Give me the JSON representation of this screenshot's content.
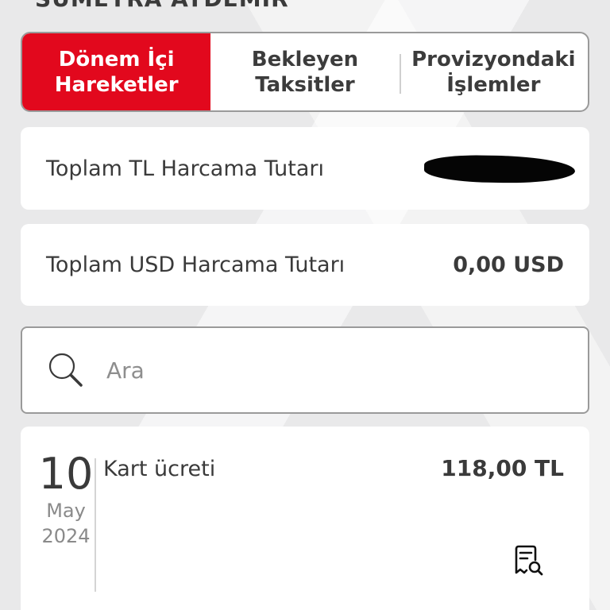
{
  "header": {
    "owner_name": "SÜMEYRA AYDEMİR"
  },
  "tabs": [
    {
      "label_line1": "Dönem İçi",
      "label_line2": "Hareketler",
      "active": true
    },
    {
      "label_line1": "Bekleyen",
      "label_line2": "Taksitler",
      "active": false
    },
    {
      "label_line1": "Provizyondaki",
      "label_line2": "İşlemler",
      "active": false
    }
  ],
  "summary": {
    "tl_label": "Toplam TL Harcama Tutarı",
    "tl_value": "",
    "usd_label": "Toplam USD Harcama Tutarı",
    "usd_value": "0,00 USD"
  },
  "search": {
    "placeholder": "Ara",
    "value": "",
    "icon": "search-icon"
  },
  "transactions": [
    {
      "day": "10",
      "month": "May",
      "year": "2024",
      "description": "Kart ücreti",
      "amount": "118,00 TL",
      "icon": "receipt-search-icon"
    }
  ],
  "colors": {
    "accent": "#e2081d",
    "text": "#3a3a3a",
    "muted": "#8a8a8a",
    "border": "#9a9a9a"
  }
}
